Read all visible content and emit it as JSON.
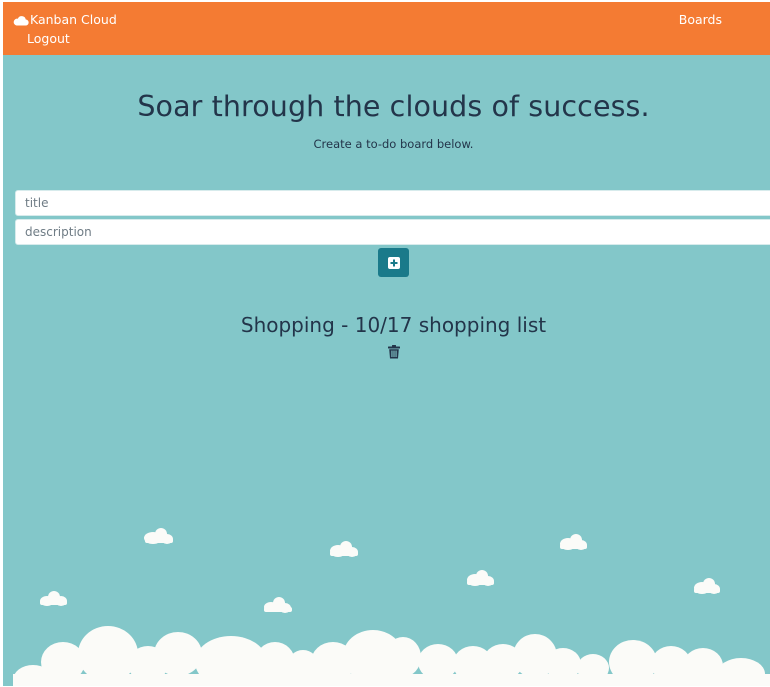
{
  "navbar": {
    "brand_label": "Kanban Cloud",
    "boards_label": "Boards",
    "logout_label": "Logout"
  },
  "hero": {
    "title": "Soar through the clouds of success.",
    "subtitle": "Create a to-do board below."
  },
  "form": {
    "title_placeholder": "title",
    "description_placeholder": "description",
    "add_icon": "plus-square-icon"
  },
  "boards": [
    {
      "title": "Shopping - 10/17 shopping list",
      "delete_icon": "trash-icon"
    }
  ],
  "colors": {
    "navbar": "#f47b33",
    "background": "#83c7c9",
    "heading_text": "#23354a",
    "add_button": "#1a7a8a",
    "cloud": "#fbfbf8"
  }
}
